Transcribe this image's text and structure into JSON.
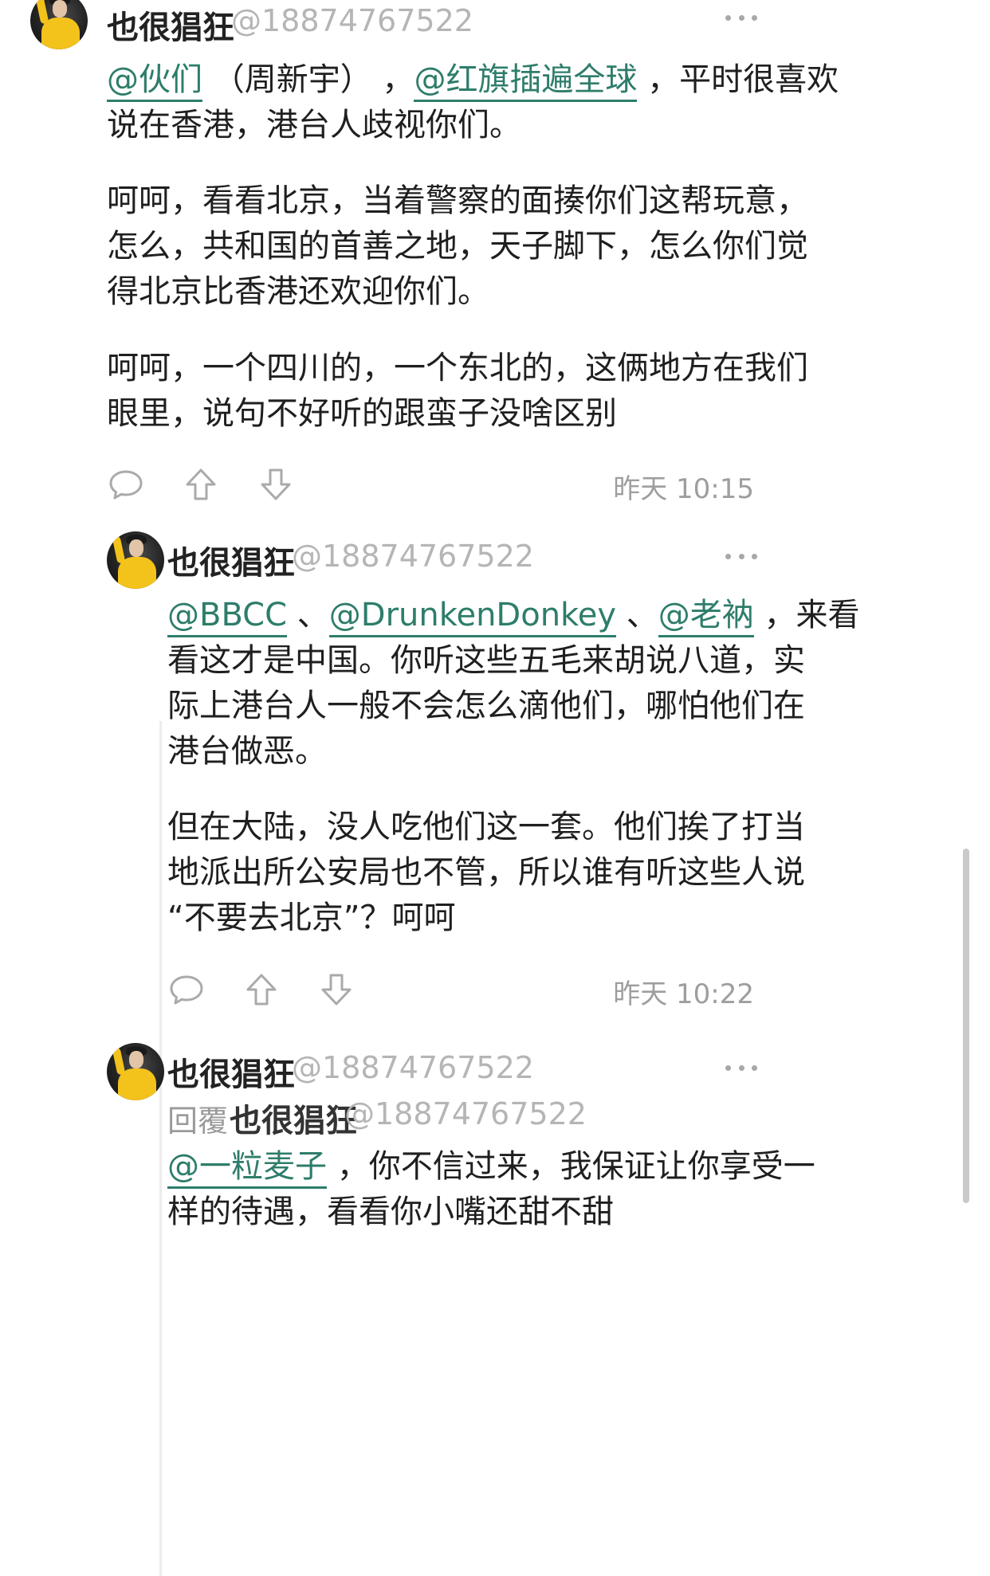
{
  "comments": [
    {
      "author": "也很猖狂",
      "handle": "@18874767522",
      "paragraphs": [
        {
          "lines": [
            [
              {
                "type": "mention",
                "text": "@伙们"
              },
              {
                "type": "text",
                "text": " （周新宇） ，"
              },
              {
                "type": "mention",
                "text": "@红旗插遍全球"
              },
              {
                "type": "text",
                "text": " ，平时很喜欢"
              }
            ],
            [
              {
                "type": "text",
                "text": "说在香港，港台人歧视你们。"
              }
            ]
          ]
        },
        {
          "lines": [
            [
              {
                "type": "text",
                "text": "呵呵，看看北京，当着警察的面揍你们这帮玩意，"
              }
            ],
            [
              {
                "type": "text",
                "text": "怎么，共和国的首善之地，天子脚下，怎么你们觉"
              }
            ],
            [
              {
                "type": "text",
                "text": "得北京比香港还欢迎你们。"
              }
            ]
          ]
        },
        {
          "lines": [
            [
              {
                "type": "text",
                "text": "呵呵，一个四川的，一个东北的，这俩地方在我们"
              }
            ],
            [
              {
                "type": "text",
                "text": "眼里，说句不好听的跟蛮子没啥区别"
              }
            ]
          ]
        }
      ],
      "time": "昨天 10:15"
    },
    {
      "author": "也很猖狂",
      "handle": "@18874767522",
      "paragraphs": [
        {
          "lines": [
            [
              {
                "type": "mention",
                "text": "@BBCC"
              },
              {
                "type": "text",
                "text": " 、"
              },
              {
                "type": "mention",
                "text": "@DrunkenDonkey"
              },
              {
                "type": "text",
                "text": " 、"
              },
              {
                "type": "mention",
                "text": "@老衲"
              },
              {
                "type": "text",
                "text": " ，来看"
              }
            ],
            [
              {
                "type": "text",
                "text": "看这才是中国。你听这些五毛来胡说八道，实"
              }
            ],
            [
              {
                "type": "text",
                "text": "际上港台人一般不会怎么滴他们，哪怕他们在"
              }
            ],
            [
              {
                "type": "text",
                "text": "港台做恶。"
              }
            ]
          ]
        },
        {
          "lines": [
            [
              {
                "type": "text",
                "text": "但在大陆，没人吃他们这一套。他们挨了打当"
              }
            ],
            [
              {
                "type": "text",
                "text": "地派出所公安局也不管，所以谁有听这些人说"
              }
            ],
            [
              {
                "type": "text",
                "text": "“不要去北京”？呵呵"
              }
            ]
          ]
        }
      ],
      "time": "昨天 10:22"
    },
    {
      "author": "也很猖狂",
      "handle": "@18874767522",
      "reply_label": "回覆",
      "reply_to_name": "也很猖狂",
      "reply_to_handle": "@18874767522",
      "paragraphs": [
        {
          "lines": [
            [
              {
                "type": "mention",
                "text": "@一粒麦子"
              },
              {
                "type": "text",
                "text": " ，你不信过来，我保证让你享受一"
              }
            ],
            [
              {
                "type": "text",
                "text": "样的待遇，看看你小嘴还甜不甜"
              }
            ]
          ]
        }
      ]
    }
  ],
  "icons": {
    "comment": "comment-bubble-icon",
    "upvote": "upvote-arrow-icon",
    "downvote": "downvote-arrow-icon",
    "more": "more-dots-icon"
  },
  "colors": {
    "mention": "#2e7d6b",
    "name": "#222222",
    "muted": "#b5b5b5",
    "time": "#9e9e9e"
  }
}
